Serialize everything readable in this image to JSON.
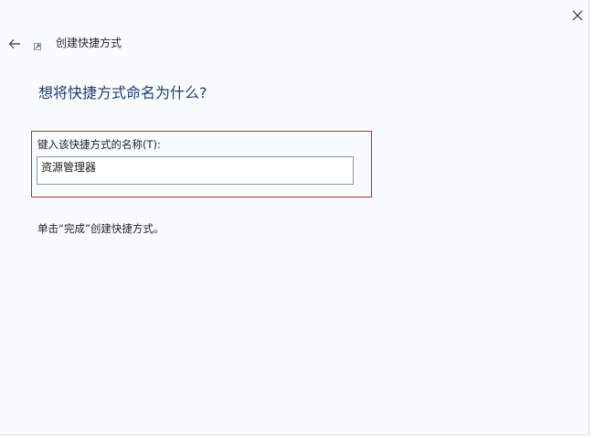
{
  "window": {
    "close_icon": "close-icon",
    "back_icon": "back-arrow-icon",
    "title": "创建快捷方式"
  },
  "page": {
    "heading": "想将快捷方式命名为什么?",
    "field_label": "键入该快捷方式的名称(T):",
    "field_value": "资源管理器",
    "instruction": "单击“完成”创建快捷方式。"
  },
  "colors": {
    "heading": "#1e3f73",
    "highlight_border": "#c0282f",
    "input_border": "#7a9ab8"
  }
}
